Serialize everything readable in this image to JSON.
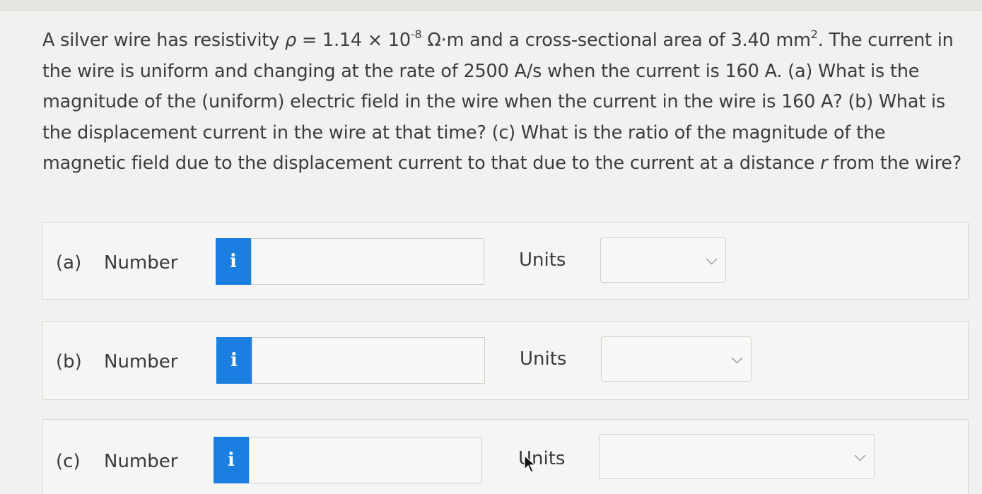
{
  "question": {
    "line1_pre": "A silver wire has resistivity ",
    "rho": "ρ",
    "line1_mid": " = 1.14 × 10",
    "exp1": "-8",
    "line1_mid2": " Ω·m and a cross-sectional area of 3.40 mm",
    "exp2": "2",
    "line1_post": ". The current in the wire is uniform and changing at the rate of 2500 A/s when the current is 160 A. (a) What is the magnitude of the (uniform) electric field in the wire when the current in the wire is 160 A? (b) What is the displacement current in the wire at that time? (c) What is the ratio of the magnitude of the magnetic field due to the displacement current to that due to the current at a distance ",
    "r": "r",
    "line_end": " from the wire?"
  },
  "parts": [
    {
      "label": "(a)",
      "number_label": "Number",
      "info": "i",
      "value": "",
      "units_label": "Units",
      "units_value": ""
    },
    {
      "label": "(b)",
      "number_label": "Number",
      "info": "i",
      "value": "",
      "units_label": "Units",
      "units_value": ""
    },
    {
      "label": "(c)",
      "number_label": "Number",
      "info": "i",
      "value": "",
      "units_label": "Units",
      "units_value": ""
    }
  ],
  "icons": {
    "info": "info-icon",
    "dropdown": "chevron-down-icon",
    "cursor": "mouse-pointer-icon"
  },
  "colors": {
    "info_button": "#1a7fe0",
    "background": "#f1f1ef"
  }
}
